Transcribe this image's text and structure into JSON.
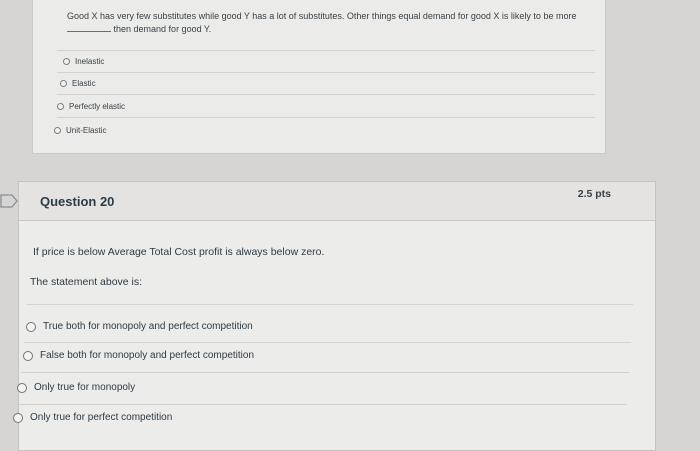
{
  "previous_question": {
    "text_part1": "Good X has very few substitutes while good Y has a lot of substitutes. Other things equal demand for good X is likely to be more",
    "text_part2": "then demand for good Y.",
    "options": [
      "Inelastic",
      "Elastic",
      "Perfectly elastic",
      "Unit-Elastic"
    ]
  },
  "question": {
    "title": "Question 20",
    "points": "2.5 pts",
    "prompt": "If price is below Average Total Cost profit is always below zero.",
    "subprompt": "The statement above is:",
    "answers": [
      "True both for monopoly and perfect competition",
      "False both for monopoly and perfect competition",
      "Only true for monopoly",
      "Only true for perfect competition"
    ]
  }
}
